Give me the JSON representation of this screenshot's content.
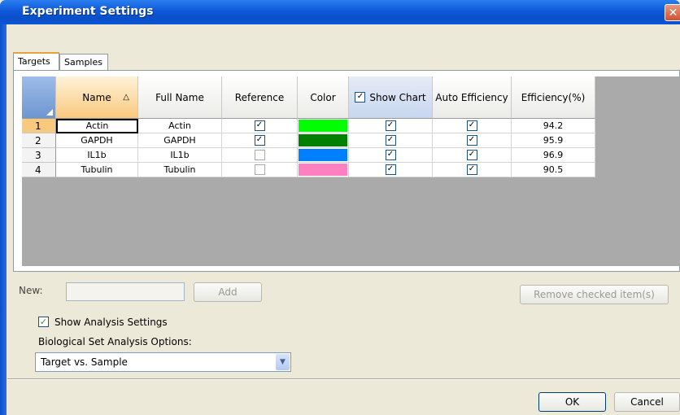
{
  "window": {
    "title": "Experiment Settings",
    "close_glyph": "✕"
  },
  "tabs": [
    "Targets",
    "Samples"
  ],
  "grid": {
    "columns": [
      "Name",
      "Full Name",
      "Reference",
      "Color",
      "Show Chart",
      "Auto Efficiency",
      "Efficiency(%)"
    ],
    "sort_glyph": "△",
    "rows": [
      {
        "num": "1",
        "name": "Actin",
        "full_name": "Actin",
        "reference": true,
        "color": "#00ff00",
        "show_chart": true,
        "auto_eff": true,
        "efficiency": "94.2"
      },
      {
        "num": "2",
        "name": "GAPDH",
        "full_name": "GAPDH",
        "reference": true,
        "color": "#008000",
        "show_chart": true,
        "auto_eff": true,
        "efficiency": "95.9"
      },
      {
        "num": "3",
        "name": "IL1b",
        "full_name": "IL1b",
        "reference": false,
        "color": "#0080ff",
        "show_chart": true,
        "auto_eff": true,
        "efficiency": "96.9"
      },
      {
        "num": "4",
        "name": "Tubulin",
        "full_name": "Tubulin",
        "reference": false,
        "color": "#ff80c0",
        "show_chart": true,
        "auto_eff": true,
        "efficiency": "90.5"
      }
    ]
  },
  "new_target": {
    "label": "New:",
    "value": "",
    "add_label": "Add"
  },
  "remove_label": "Remove checked item(s)",
  "show_analysis": {
    "label": "Show Analysis Settings",
    "checked": true
  },
  "bio_set": {
    "label": "Biological Set Analysis Options:",
    "value": "Target vs. Sample"
  },
  "footer": {
    "ok_label": "OK",
    "cancel_label": "Cancel"
  },
  "check_glyph": "✓"
}
